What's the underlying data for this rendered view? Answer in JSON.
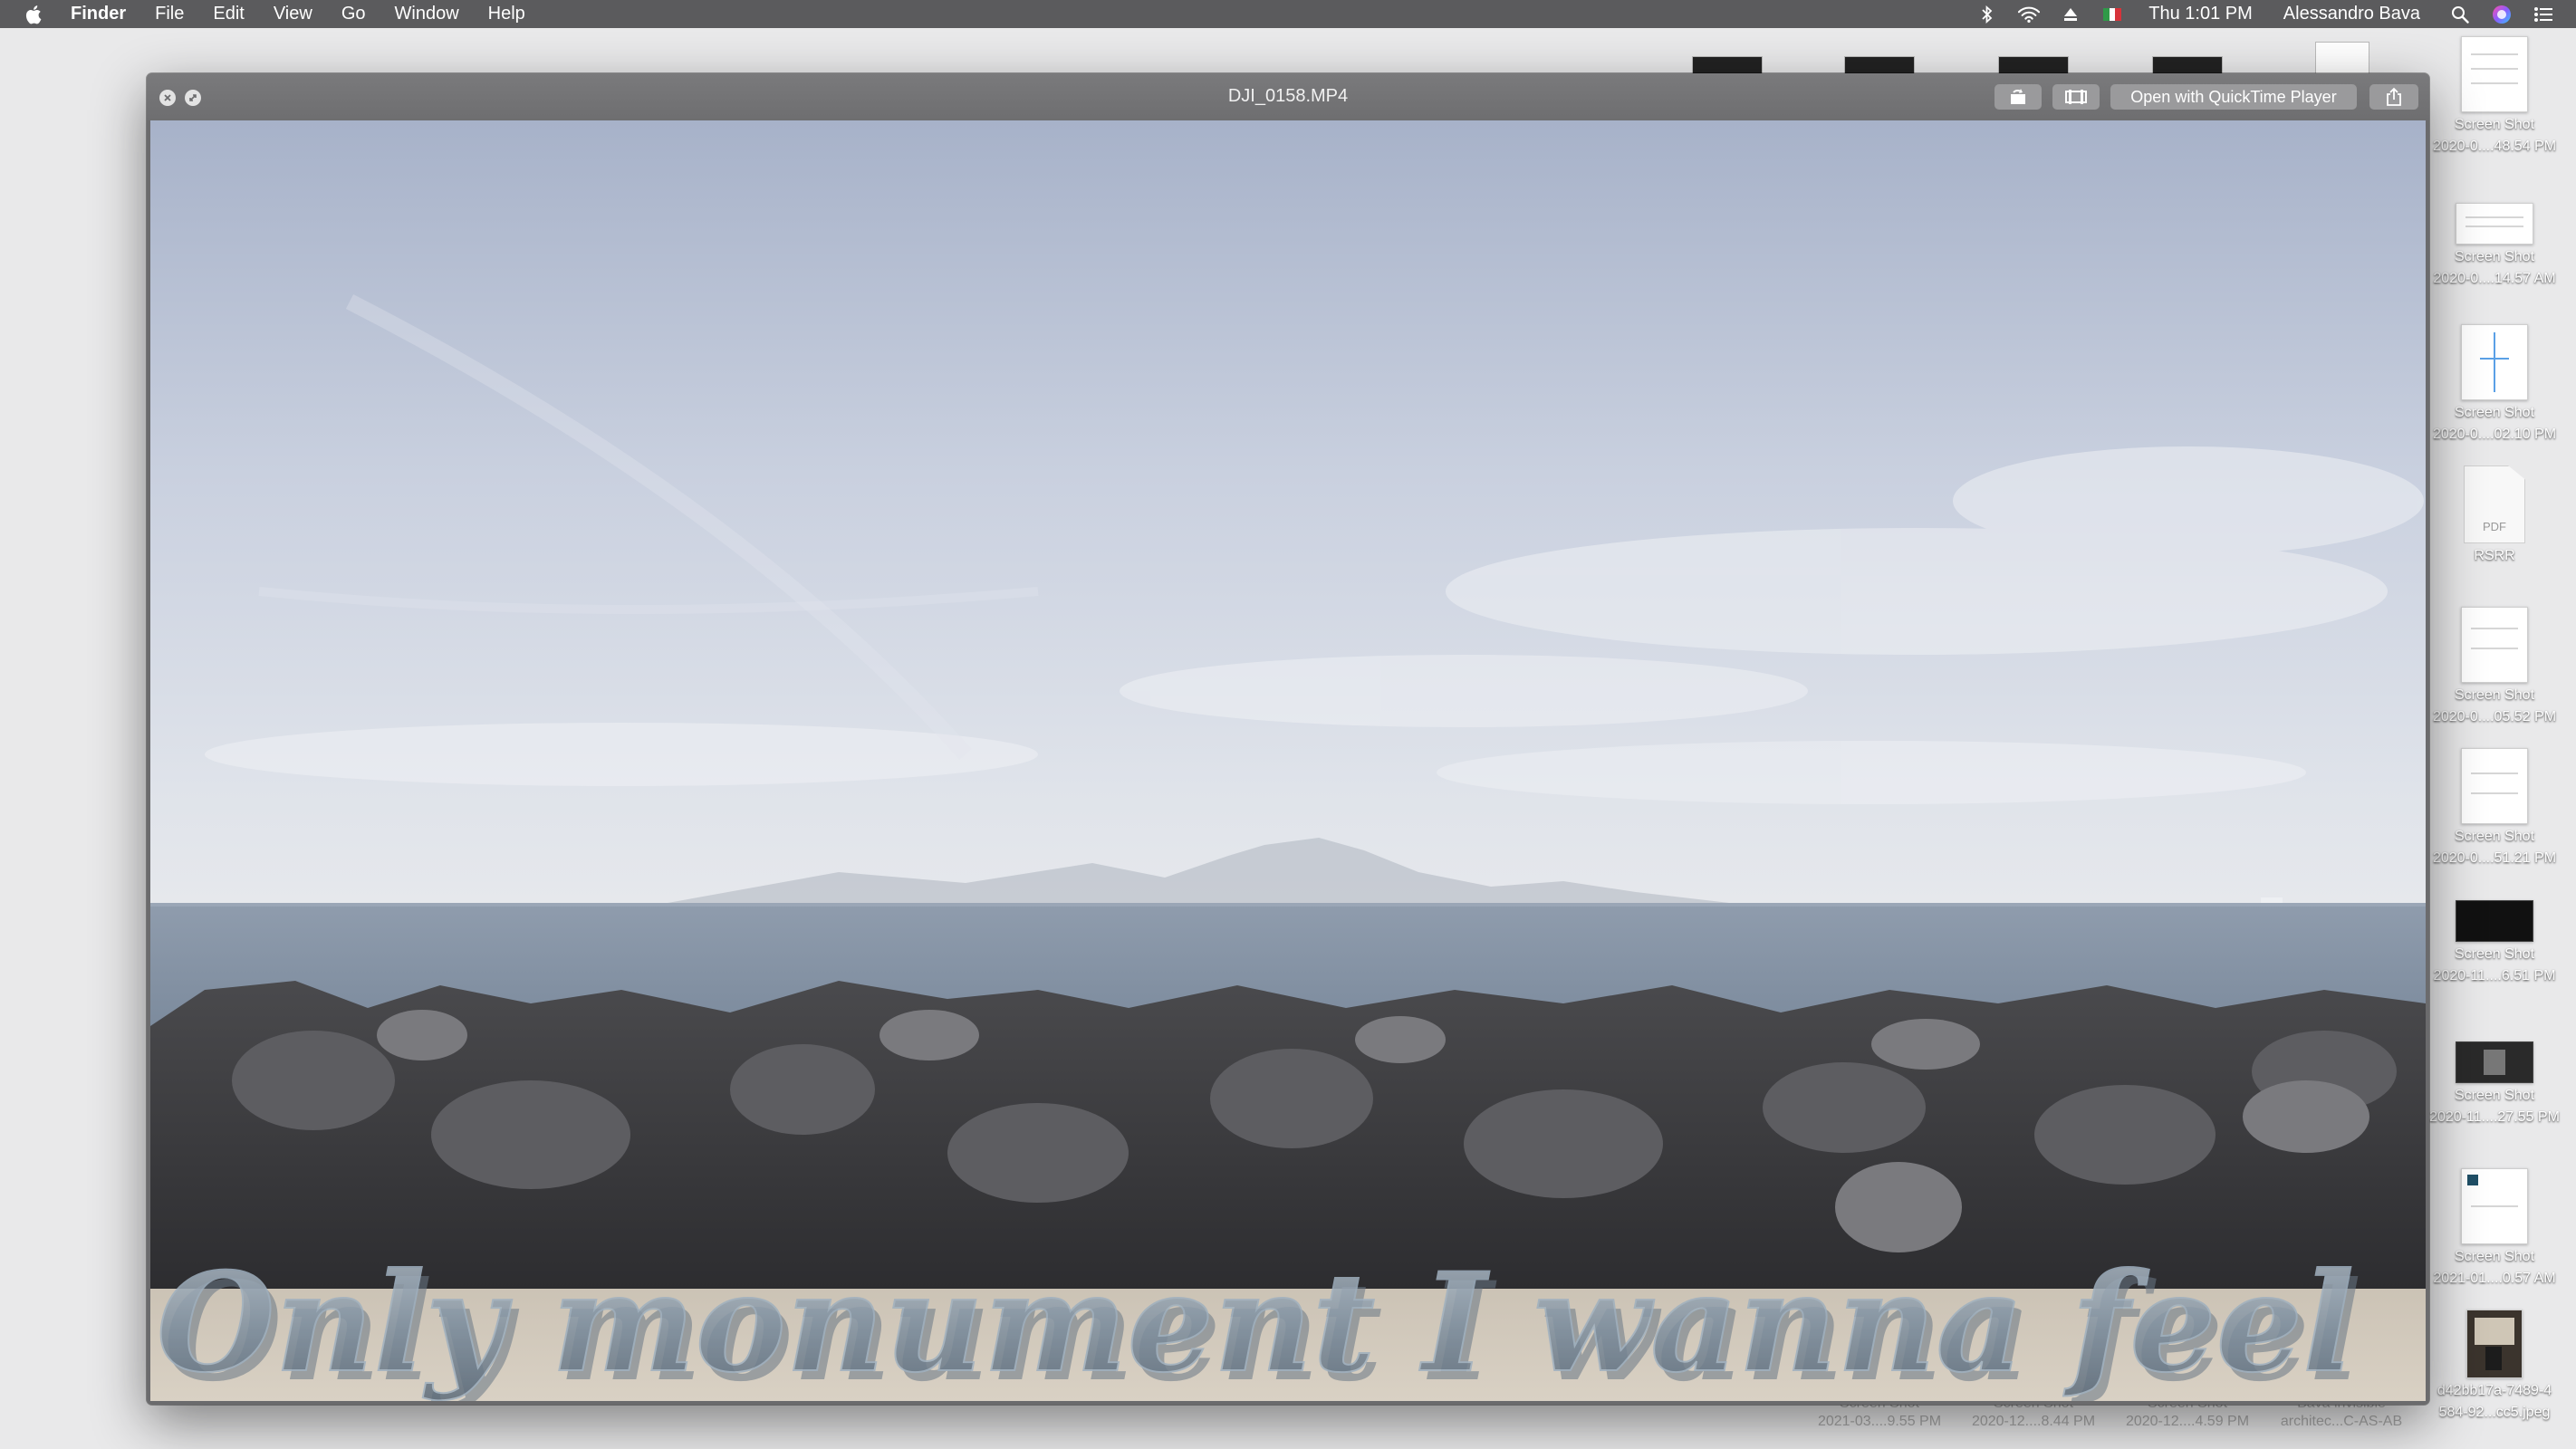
{
  "menubar": {
    "app": "Finder",
    "items": [
      "File",
      "Edit",
      "View",
      "Go",
      "Window",
      "Help"
    ],
    "clock": "Thu 1:01 PM",
    "user": "Alessandro Bava"
  },
  "quicklook": {
    "title": "DJI_0158.MP4",
    "open_button": "Open with QuickTime Player",
    "overlay_text": "Only monument I wanna feel"
  },
  "desktop": {
    "icons": [
      {
        "line1": "Screen Shot",
        "line2": "2020-0....48.54 PM",
        "kind": "portrait"
      },
      {
        "line1": "Screen Shot",
        "line2": "2020-0....14.57 AM",
        "kind": "land"
      },
      {
        "line1": "Screen Shot",
        "line2": "2020-0....02.10 PM",
        "kind": "portrait"
      },
      {
        "line1": "RSRR",
        "line2": "",
        "kind": "pdf",
        "badge": "PDF"
      },
      {
        "line1": "Screen Shot",
        "line2": "2020-0....05.52 PM",
        "kind": "portrait"
      },
      {
        "line1": "Screen Shot",
        "line2": "2020-0....51.21 PM",
        "kind": "portrait"
      },
      {
        "line1": "Screen Shot",
        "line2": "2020-11....6.51 PM",
        "kind": "dark"
      },
      {
        "line1": "Screen Shot",
        "line2": "2020-11....27.55 PM",
        "kind": "dark"
      },
      {
        "line1": "Screen Shot",
        "line2": "2021-01....0.57 AM",
        "kind": "portrait"
      },
      {
        "line1": "d42bb17a-7489-4",
        "line2": "584-92...cc5.jpeg",
        "kind": "photo"
      }
    ],
    "bottom": [
      {
        "line1": "Screen Shot",
        "line2": "2021-03....9.55 PM"
      },
      {
        "line1": "Screen Shot",
        "line2": "2020-12....8.44 PM"
      },
      {
        "line1": "Screen Shot",
        "line2": "2020-12....4.59 PM"
      },
      {
        "line1": "Bava invisible",
        "line2": "architec...C-AS-AB"
      }
    ]
  }
}
